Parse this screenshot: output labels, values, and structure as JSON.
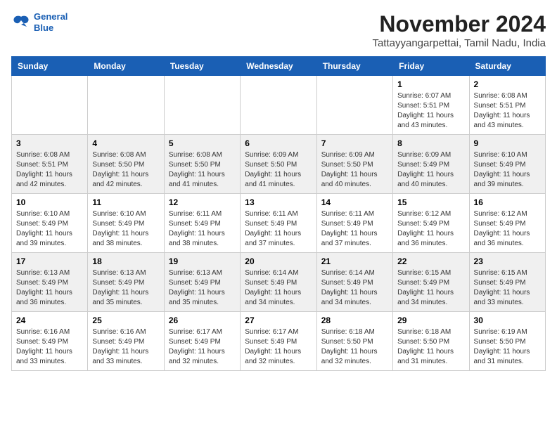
{
  "header": {
    "logo_line1": "General",
    "logo_line2": "Blue",
    "title": "November 2024",
    "subtitle": "Tattayyangarpettai, Tamil Nadu, India"
  },
  "calendar": {
    "days_of_week": [
      "Sunday",
      "Monday",
      "Tuesday",
      "Wednesday",
      "Thursday",
      "Friday",
      "Saturday"
    ],
    "weeks": [
      [
        {
          "day": "",
          "info": ""
        },
        {
          "day": "",
          "info": ""
        },
        {
          "day": "",
          "info": ""
        },
        {
          "day": "",
          "info": ""
        },
        {
          "day": "",
          "info": ""
        },
        {
          "day": "1",
          "info": "Sunrise: 6:07 AM\nSunset: 5:51 PM\nDaylight: 11 hours and 43 minutes."
        },
        {
          "day": "2",
          "info": "Sunrise: 6:08 AM\nSunset: 5:51 PM\nDaylight: 11 hours and 43 minutes."
        }
      ],
      [
        {
          "day": "3",
          "info": "Sunrise: 6:08 AM\nSunset: 5:51 PM\nDaylight: 11 hours and 42 minutes."
        },
        {
          "day": "4",
          "info": "Sunrise: 6:08 AM\nSunset: 5:50 PM\nDaylight: 11 hours and 42 minutes."
        },
        {
          "day": "5",
          "info": "Sunrise: 6:08 AM\nSunset: 5:50 PM\nDaylight: 11 hours and 41 minutes."
        },
        {
          "day": "6",
          "info": "Sunrise: 6:09 AM\nSunset: 5:50 PM\nDaylight: 11 hours and 41 minutes."
        },
        {
          "day": "7",
          "info": "Sunrise: 6:09 AM\nSunset: 5:50 PM\nDaylight: 11 hours and 40 minutes."
        },
        {
          "day": "8",
          "info": "Sunrise: 6:09 AM\nSunset: 5:49 PM\nDaylight: 11 hours and 40 minutes."
        },
        {
          "day": "9",
          "info": "Sunrise: 6:10 AM\nSunset: 5:49 PM\nDaylight: 11 hours and 39 minutes."
        }
      ],
      [
        {
          "day": "10",
          "info": "Sunrise: 6:10 AM\nSunset: 5:49 PM\nDaylight: 11 hours and 39 minutes."
        },
        {
          "day": "11",
          "info": "Sunrise: 6:10 AM\nSunset: 5:49 PM\nDaylight: 11 hours and 38 minutes."
        },
        {
          "day": "12",
          "info": "Sunrise: 6:11 AM\nSunset: 5:49 PM\nDaylight: 11 hours and 38 minutes."
        },
        {
          "day": "13",
          "info": "Sunrise: 6:11 AM\nSunset: 5:49 PM\nDaylight: 11 hours and 37 minutes."
        },
        {
          "day": "14",
          "info": "Sunrise: 6:11 AM\nSunset: 5:49 PM\nDaylight: 11 hours and 37 minutes."
        },
        {
          "day": "15",
          "info": "Sunrise: 6:12 AM\nSunset: 5:49 PM\nDaylight: 11 hours and 36 minutes."
        },
        {
          "day": "16",
          "info": "Sunrise: 6:12 AM\nSunset: 5:49 PM\nDaylight: 11 hours and 36 minutes."
        }
      ],
      [
        {
          "day": "17",
          "info": "Sunrise: 6:13 AM\nSunset: 5:49 PM\nDaylight: 11 hours and 36 minutes."
        },
        {
          "day": "18",
          "info": "Sunrise: 6:13 AM\nSunset: 5:49 PM\nDaylight: 11 hours and 35 minutes."
        },
        {
          "day": "19",
          "info": "Sunrise: 6:13 AM\nSunset: 5:49 PM\nDaylight: 11 hours and 35 minutes."
        },
        {
          "day": "20",
          "info": "Sunrise: 6:14 AM\nSunset: 5:49 PM\nDaylight: 11 hours and 34 minutes."
        },
        {
          "day": "21",
          "info": "Sunrise: 6:14 AM\nSunset: 5:49 PM\nDaylight: 11 hours and 34 minutes."
        },
        {
          "day": "22",
          "info": "Sunrise: 6:15 AM\nSunset: 5:49 PM\nDaylight: 11 hours and 34 minutes."
        },
        {
          "day": "23",
          "info": "Sunrise: 6:15 AM\nSunset: 5:49 PM\nDaylight: 11 hours and 33 minutes."
        }
      ],
      [
        {
          "day": "24",
          "info": "Sunrise: 6:16 AM\nSunset: 5:49 PM\nDaylight: 11 hours and 33 minutes."
        },
        {
          "day": "25",
          "info": "Sunrise: 6:16 AM\nSunset: 5:49 PM\nDaylight: 11 hours and 33 minutes."
        },
        {
          "day": "26",
          "info": "Sunrise: 6:17 AM\nSunset: 5:49 PM\nDaylight: 11 hours and 32 minutes."
        },
        {
          "day": "27",
          "info": "Sunrise: 6:17 AM\nSunset: 5:49 PM\nDaylight: 11 hours and 32 minutes."
        },
        {
          "day": "28",
          "info": "Sunrise: 6:18 AM\nSunset: 5:50 PM\nDaylight: 11 hours and 32 minutes."
        },
        {
          "day": "29",
          "info": "Sunrise: 6:18 AM\nSunset: 5:50 PM\nDaylight: 11 hours and 31 minutes."
        },
        {
          "day": "30",
          "info": "Sunrise: 6:19 AM\nSunset: 5:50 PM\nDaylight: 11 hours and 31 minutes."
        }
      ]
    ]
  }
}
